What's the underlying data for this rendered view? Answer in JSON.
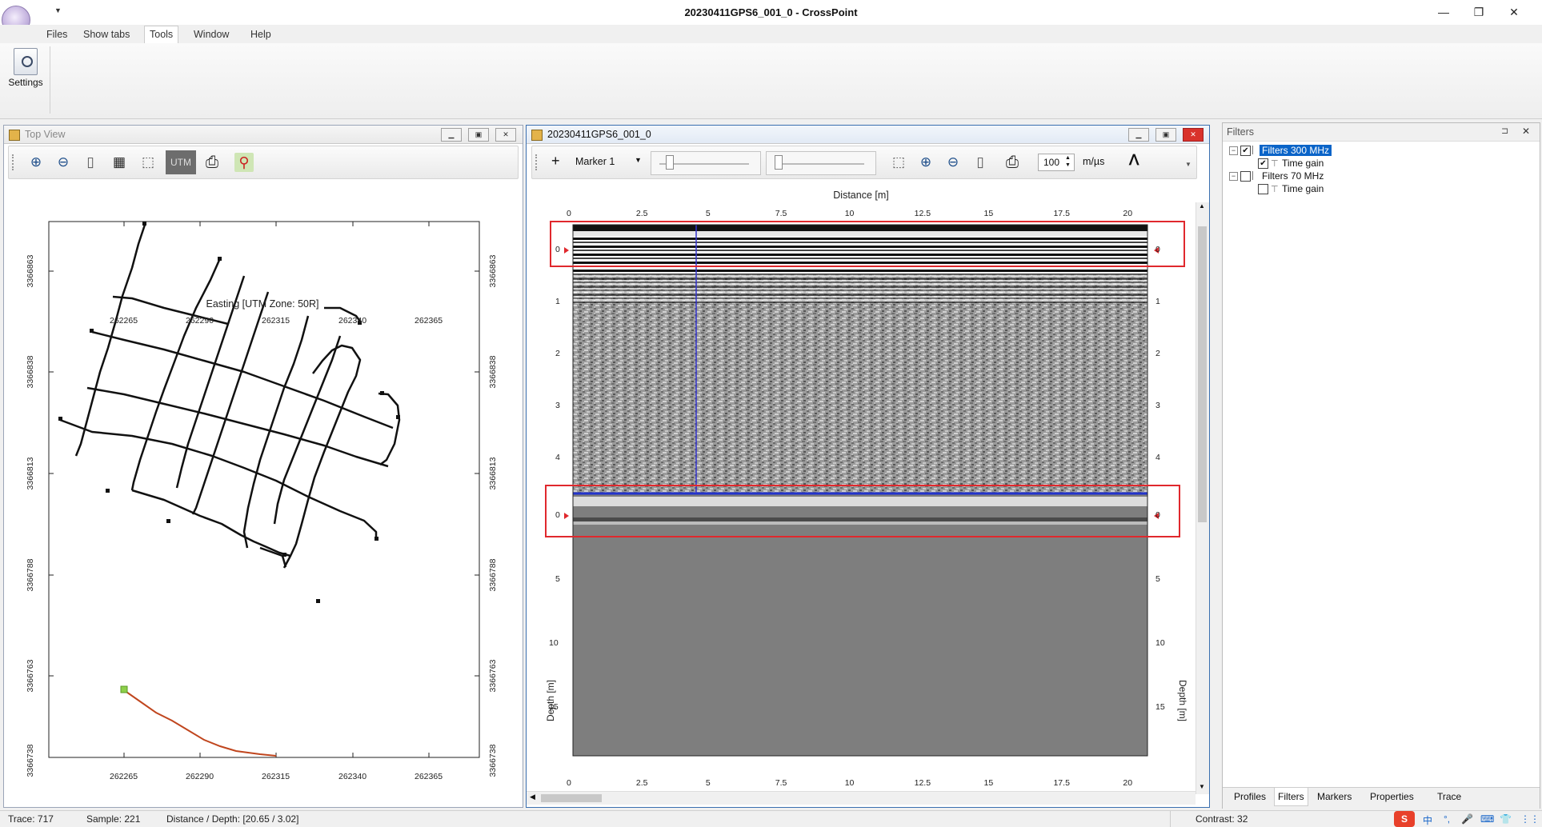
{
  "window": {
    "title": "20230411GPS6_001_0 - CrossPoint",
    "controls": [
      "—",
      "❐",
      "✕"
    ]
  },
  "menu": [
    "Files",
    "Show tabs",
    "Tools",
    "Window",
    "Help"
  ],
  "ribbon": {
    "settings_label": "Settings"
  },
  "top_view": {
    "title": "Top View",
    "utm_label": "UTM",
    "easting_label": "Easting [UTM Zone: 50R]",
    "easting_ticks": [
      "262265",
      "262290",
      "262315",
      "262340",
      "262365"
    ],
    "northing_ticks": [
      "3366863",
      "3366838",
      "3366813",
      "3366788",
      "3366763",
      "3366738"
    ]
  },
  "profile": {
    "title": "20230411GPS6_001_0",
    "marker_label": "Marker 1",
    "velocity_value": "100",
    "velocity_unit": "m/µs",
    "plus": "+",
    "peak": "ᐱ",
    "distance_label": "Distance [m]",
    "depth_label": "Depth [m]",
    "distance_ticks": [
      "0",
      "2.5",
      "5",
      "7.5",
      "10",
      "12.5",
      "15",
      "17.5",
      "20"
    ],
    "upper_depth_ticks": [
      "0",
      "1",
      "2",
      "3",
      "4"
    ],
    "lower_depth_ticks": [
      "0",
      "5",
      "10",
      "15"
    ]
  },
  "filters": {
    "title": "Filters",
    "pin": "⊐",
    "close": "✕",
    "groups": [
      {
        "label": "Filters  300 MHz",
        "checked": true,
        "child": "Time gain",
        "child_checked": true
      },
      {
        "label": "Filters  70 MHz",
        "checked": false,
        "child": "Time gain",
        "child_checked": false
      }
    ],
    "tabs": [
      "Profiles",
      "Filters",
      "Markers",
      "Properties",
      "Trace"
    ]
  },
  "status": {
    "trace": "Trace: 717",
    "sample": "Sample: 221",
    "distance_depth": "Distance / Depth: [20.65 / 3.02]",
    "contrast": "Contrast: 32"
  },
  "tray": [
    "中",
    "°,",
    "🎤",
    "⌨",
    "👕",
    "⋮⋮"
  ],
  "colors": {
    "title_bar": "#ffffff",
    "selection": "#0a64c8",
    "highlight_box": "#e0282d",
    "marker_line": "#3333cc",
    "track": "#111111",
    "gps_track": "#c0461e"
  }
}
